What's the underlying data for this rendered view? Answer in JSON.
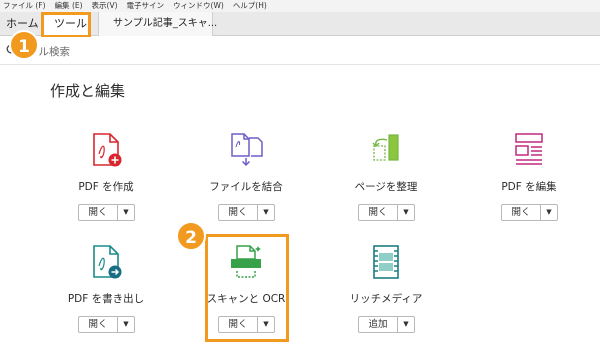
{
  "menubar": [
    "ファイル (F)",
    "編集 (E)",
    "表示(V)",
    "電子サイン",
    "ウィンドウ(W)",
    "ヘルプ(H)"
  ],
  "tabs": {
    "home": "ホーム",
    "tools": "ツール",
    "document": "サンプル記事_スキャ..."
  },
  "search": {
    "text": "ール検索"
  },
  "callouts": [
    "1",
    "2"
  ],
  "section_title": "作成と編集",
  "tools": [
    {
      "label": "PDF を作成",
      "button": "開く",
      "icon": "create-pdf-icon"
    },
    {
      "label": "ファイルを結合",
      "button": "開く",
      "icon": "combine-files-icon"
    },
    {
      "label": "ページを整理",
      "button": "開く",
      "icon": "organize-pages-icon"
    },
    {
      "label": "PDF を編集",
      "button": "開く",
      "icon": "edit-pdf-icon"
    },
    {
      "label": "PDF を書き出し",
      "button": "開く",
      "icon": "export-pdf-icon"
    },
    {
      "label": "スキャンと OCR",
      "button": "開く",
      "icon": "scan-ocr-icon"
    },
    {
      "label": "リッチメディア",
      "button": "追加",
      "icon": "rich-media-icon"
    }
  ],
  "colors": {
    "accent": "#f29a1f",
    "create": "#d9262e",
    "combine": "#6b5fc7",
    "organize": "#74b644",
    "edit": "#c2287d",
    "export": "#1a8b8b",
    "scan": "#37a24a",
    "media": "#1f7d84"
  }
}
